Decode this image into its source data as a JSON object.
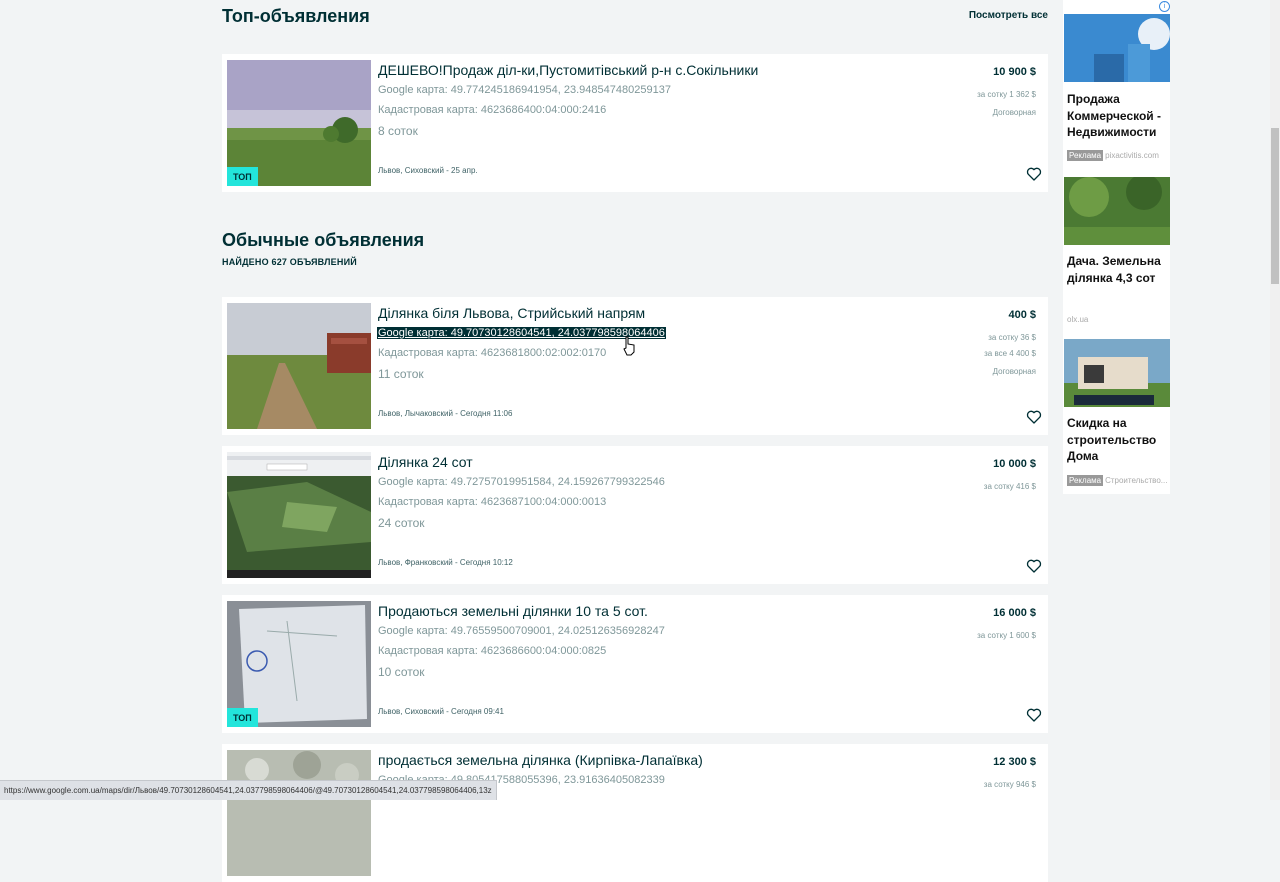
{
  "top_section": {
    "title": "Топ-объявления",
    "see_all": "Посмотреть все"
  },
  "regular_section": {
    "title": "Обычные объявления",
    "found": "НАЙДЕНО 627 ОБЪЯВЛЕНИЙ"
  },
  "listings": [
    {
      "title": "ДЕШЕВО!Продаж діл-ки,Пустомитівський р-н с.Сокільники",
      "google": "Google карта: 49.774245186941954, 23.948547480259137",
      "cadastre": "Кадастровая карта: 4623686400:04:000:2416",
      "size": "8 соток",
      "location": "Львов, Сиховский - 25 апр.",
      "price": "10 900 $",
      "per_sotka": "за сотку 1 362 $",
      "total": "",
      "negotiable": "Договорная",
      "badge": "ТОП"
    },
    {
      "title": "Ділянка біля Львова, Стрийський напрям",
      "google": "Google карта: 49.70730128604541, 24.037798598064406",
      "cadastre": "Кадастровая карта: 4623681800:02:002:0170",
      "size": "11 соток",
      "location": "Львов, Лычаковский - Сегодня 11:06",
      "price": "400 $",
      "per_sotka": "за сотку 36 $",
      "total": "за все 4 400 $",
      "negotiable": "Договорная",
      "badge": ""
    },
    {
      "title": "Ділянка 24 сот",
      "google": "Google карта: 49.72757019951584, 24.159267799322546",
      "cadastre": "Кадастровая карта: 4623687100:04:000:0013",
      "size": "24 соток",
      "location": "Львов, Франковский - Сегодня 10:12",
      "price": "10 000 $",
      "per_sotka": "за сотку 416 $",
      "total": "",
      "negotiable": "",
      "badge": ""
    },
    {
      "title": "Продаються земельні ділянки 10 та 5 сот.",
      "google": "Google карта: 49.76559500709001, 24.025126356928247",
      "cadastre": "Кадастровая карта: 4623686600:04:000:0825",
      "size": "10 соток",
      "location": "Львов, Сиховский - Сегодня 09:41",
      "price": "16 000 $",
      "per_sotka": "за сотку 1 600 $",
      "total": "",
      "negotiable": "",
      "badge": "ТОП"
    },
    {
      "title": "продається земельна ділянка (Кирпівка-Лапаївка)",
      "google": "Google карта: 49.805417588055396, 23.91636405082339",
      "cadastre": "",
      "size": "",
      "location": "",
      "price": "12 300 $",
      "per_sotka": "за сотку 946 $",
      "total": "",
      "negotiable": "",
      "badge": ""
    }
  ],
  "ads": [
    {
      "title": "Продажа Коммерческой - Недвижимости",
      "tag": "Реклама",
      "source": "pixactivitis.com"
    },
    {
      "title": "Дача. Земельна ділянка 4,3 сот",
      "tag": "",
      "source": "olx.ua"
    },
    {
      "title": "Скидка на строительство Дома",
      "tag": "Реклама",
      "source": "Строительство..."
    }
  ],
  "ad_info": "i",
  "status_url": "https://www.google.com.ua/maps/dir/Львов/49.70730128604541,24.037798598064406/@49.70730128604541,24.037798598064406,13z",
  "colors": {
    "accent": "#23e5db",
    "dark": "#002f34",
    "muted": "#7f9799",
    "background": "#f2f4f5"
  },
  "icons": [
    "heart-icon",
    "hand-cursor-icon",
    "info-icon"
  ]
}
